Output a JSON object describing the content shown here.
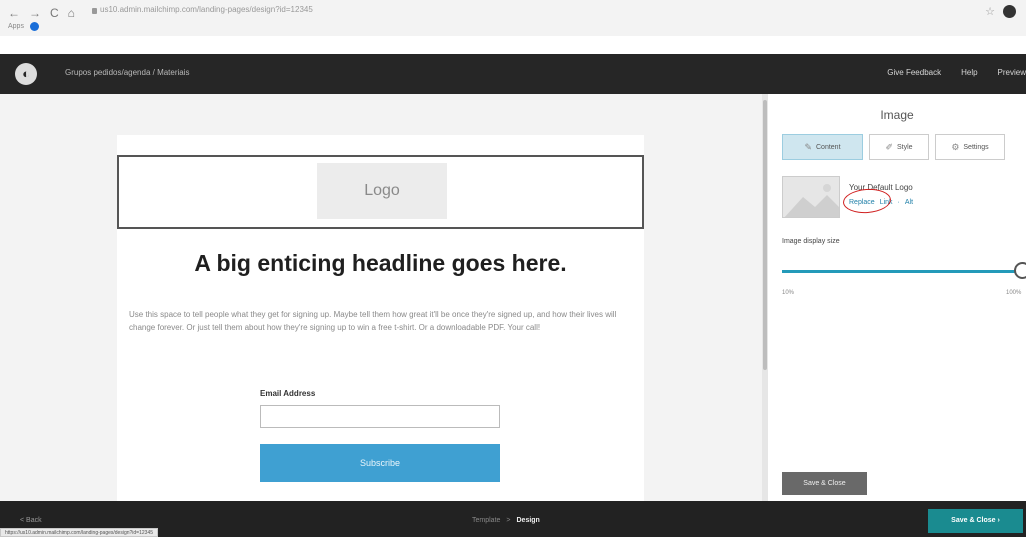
{
  "browser": {
    "nav_back": "←",
    "nav_forward": "→",
    "reload": "C",
    "home": "⌂",
    "url": "us10.admin.mailchimp.com/landing-pages/design?id=12345",
    "bookmarks_label": "Apps"
  },
  "app_header": {
    "page_name": "Grupos pedidos/agenda / Materiais",
    "links": [
      "Give Feedback",
      "Help",
      "Preview"
    ]
  },
  "canvas": {
    "logo_placeholder": "Logo",
    "headline": "A big enticing headline goes here.",
    "body": "Use this space to tell people what they get for signing up. Maybe tell them how great it'll be once they're signed up, and how their lives will change forever. Or just tell them about how they're signing up to win a free t-shirt. Or a downloadable PDF. Your call!",
    "email_label": "Email Address",
    "email_value": "",
    "subscribe": "Subscribe"
  },
  "panel": {
    "title": "Image",
    "tabs": [
      {
        "label": "Content",
        "icon": "pencil-icon"
      },
      {
        "label": "Style",
        "icon": "brush-icon"
      },
      {
        "label": "Settings",
        "icon": "gear-icon"
      }
    ],
    "logo_name": "Your Default Logo",
    "replace": "Replace",
    "link": "Link",
    "alt": "Alt",
    "link_sep": "·",
    "size_label": "Image display size",
    "size_value_pct": 100,
    "range_min": "10%",
    "range_max": "100%",
    "save_close": "Save & Close"
  },
  "bottom_bar": {
    "back": "< Back",
    "crumb_template": "Template",
    "crumb_sep": ">",
    "crumb_design": "Design",
    "save_close": "Save & Close",
    "save_close_arrow": "›",
    "status_url": "https://us10.admin.mailchimp.com/landing-pages/design?id=12345"
  },
  "colors": {
    "accent": "#239ab9",
    "header_bg": "#262626",
    "subscribe_bg": "#3fa0d2",
    "primary_button": "#1a8b90"
  }
}
